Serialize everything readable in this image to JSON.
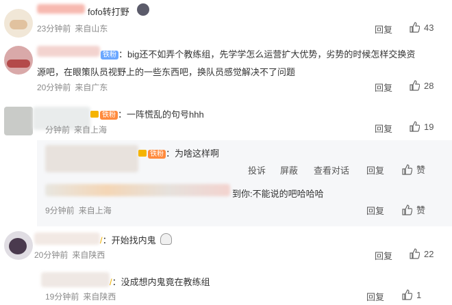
{
  "comments": [
    {
      "text": "fofo转打野",
      "time": "23分钟前",
      "location": "来自山东",
      "reply_label": "回复",
      "likes": "43"
    },
    {
      "badge": "铁粉",
      "text_line1": "big还不如弄个教练组，先学学怎么运营扩大优势，劣势的时候怎样交换资",
      "text_line2": "源吧，在眼策队员视野上的一些东西吧，换队员感觉解决不了问题",
      "time": "20分钟前",
      "location": "来自广东",
      "reply_label": "回复",
      "likes": "28"
    },
    {
      "badge": "铁粉",
      "text": "一阵慌乱的句号hhh",
      "time_partial": "分钟前",
      "location": "来自上海",
      "reply_label": "回复",
      "likes": "19",
      "replies": [
        {
          "badge": "铁粉",
          "text": "为啥这样啊",
          "actions": [
            "投诉",
            "屏蔽",
            "查看对话",
            "回复"
          ],
          "like_label": "赞"
        },
        {
          "text_partial": "到你:不能说的吧哈哈哈",
          "time": "9分钟前",
          "location": "来自上海",
          "reply_label": "回复",
          "like_label": "赞"
        }
      ]
    },
    {
      "text": "开始找内鬼",
      "time": "20分钟前",
      "location": "来自陕西",
      "reply_label": "回复",
      "likes": "22"
    },
    {
      "text": "没成想内鬼竟在教练组",
      "time": "19分钟前",
      "location": "来自陕西",
      "reply_label": "回复",
      "likes": "1"
    }
  ],
  "colors": {
    "meta_gray": "#8a8a8a",
    "fan_badge_orange": "#ff8a3d",
    "fan_badge_blue": "#6aa7ff",
    "sub_reply_bg": "#f6f7f9"
  },
  "icons": {
    "like": "thumbs-up-icon",
    "emoji_cat": "cat-emoji-icon",
    "emoji_ghost": "ghost-emoji-icon"
  }
}
